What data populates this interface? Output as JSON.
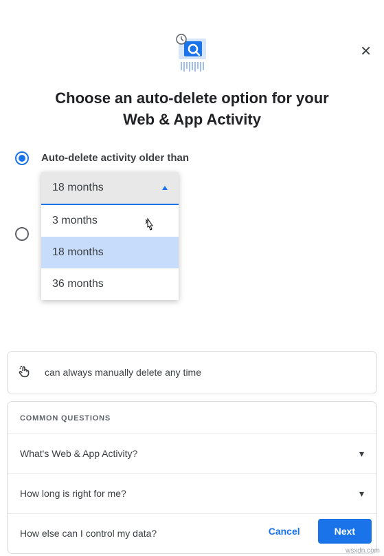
{
  "close_label": "✕",
  "title_line1": "Choose an auto-delete option for your",
  "title_line2": "Web & App Activity",
  "option_selected_label": "Auto-delete activity older than",
  "dropdown": {
    "current": "18 months",
    "options": [
      "3 months",
      "18 months",
      "36 months"
    ],
    "highlighted_index": 1
  },
  "info_text": "can always manually delete any time",
  "faq_header": "COMMON QUESTIONS",
  "faq_items": [
    "What's Web & App Activity?",
    "How long is right for me?",
    "How else can I control my data?"
  ],
  "buttons": {
    "cancel": "Cancel",
    "next": "Next"
  },
  "watermark": "wsxdn.com",
  "colors": {
    "primary": "#1a73e8"
  }
}
